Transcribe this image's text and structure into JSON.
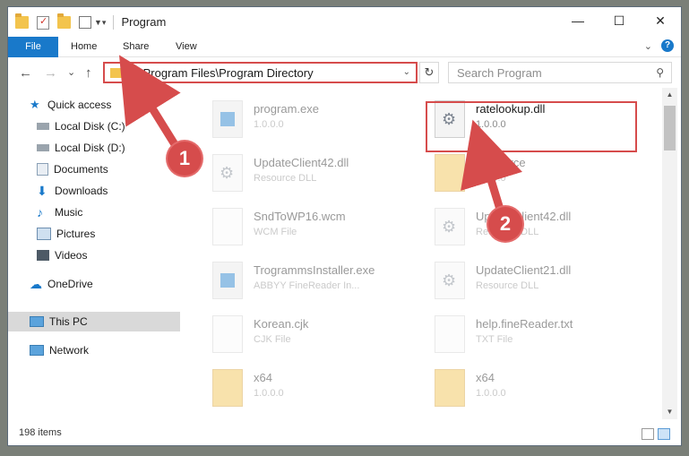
{
  "window": {
    "title": "Program",
    "controls": {
      "minimize": "—",
      "maximize": "☐",
      "close": "✕"
    }
  },
  "ribbon": {
    "tabs": [
      "File",
      "Home",
      "Share",
      "View"
    ],
    "expand_icon": "chevron-down-icon",
    "help_label": "?"
  },
  "address": {
    "path": "C:\\Program Files\\Program Directory",
    "refresh_glyph": "↻",
    "search_placeholder": "Search Program"
  },
  "nav": {
    "back": "←",
    "forward": "→",
    "recent": "⌄",
    "up": "↑"
  },
  "sidebar": {
    "items": [
      {
        "label": "Quick access",
        "icon": "star-icon"
      },
      {
        "label": "Local Disk (C:)",
        "icon": "drive-icon"
      },
      {
        "label": "Local Disk (D:)",
        "icon": "drive-icon"
      },
      {
        "label": "Documents",
        "icon": "documents-icon"
      },
      {
        "label": "Downloads",
        "icon": "download-icon"
      },
      {
        "label": "Music",
        "icon": "music-icon"
      },
      {
        "label": "Pictures",
        "icon": "pictures-icon"
      },
      {
        "label": "Videos",
        "icon": "videos-icon"
      },
      {
        "label": "OneDrive",
        "icon": "cloud-icon"
      },
      {
        "label": "This PC",
        "icon": "computer-icon"
      },
      {
        "label": "Network",
        "icon": "network-icon"
      }
    ]
  },
  "files": [
    {
      "name": "program.exe",
      "sub": "1.0.0.0",
      "icon": "app-icon"
    },
    {
      "name": "ratelookup.dll",
      "sub": "1.0.0.0",
      "icon": "gear-icon"
    },
    {
      "name": "UpdateClient42.dll",
      "sub": "Resource DLL",
      "icon": "gear-icon"
    },
    {
      "name": "Resource",
      "sub": "1.0.0.0",
      "icon": "folder-icon"
    },
    {
      "name": "SndToWP16.wcm",
      "sub": "WCM File",
      "icon": "blank-file-icon"
    },
    {
      "name": "UpdateClient42.dll",
      "sub": "Resource DLL",
      "icon": "gear-icon"
    },
    {
      "name": "TrogrammsInstaller.exe",
      "sub": "ABBYY FineReader In...",
      "icon": "app-icon"
    },
    {
      "name": "UpdateClient21.dll",
      "sub": "Resource DLL",
      "icon": "gear-icon"
    },
    {
      "name": "Korean.cjk",
      "sub": "CJK File",
      "icon": "blank-file-icon"
    },
    {
      "name": "help.fineReader.txt",
      "sub": "TXT File",
      "icon": "blank-file-icon"
    },
    {
      "name": "x64",
      "sub": "1.0.0.0",
      "icon": "folder-icon"
    },
    {
      "name": "x64",
      "sub": "1.0.0.0",
      "icon": "folder-icon"
    }
  ],
  "status": {
    "count": "198 items"
  },
  "annotations": {
    "one": "1",
    "two": "2",
    "color": "#d64c4c"
  }
}
